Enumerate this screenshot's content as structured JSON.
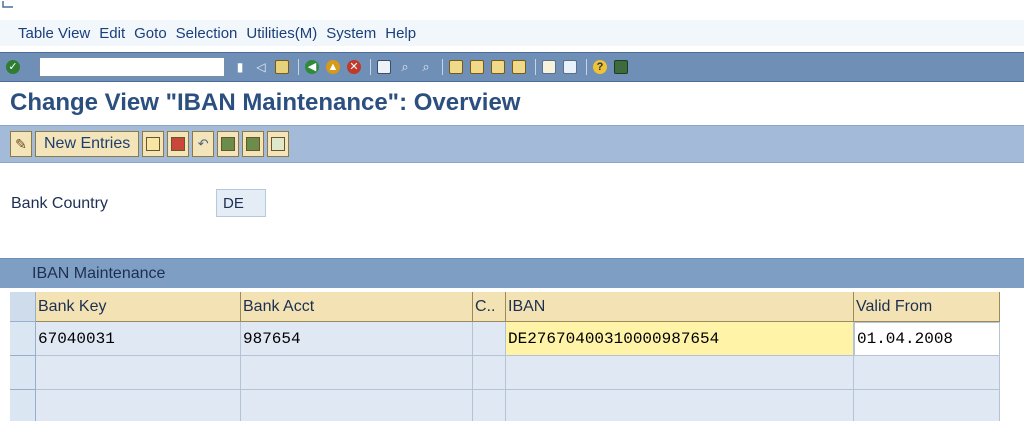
{
  "menu": [
    "Table View",
    "Edit",
    "Goto",
    "Selection",
    "Utilities(M)",
    "System",
    "Help"
  ],
  "title": "Change View \"IBAN Maintenance\": Overview",
  "toolbar_app": {
    "new_entries_label": "New Entries"
  },
  "bank_country": {
    "label": "Bank Country",
    "value": "DE"
  },
  "table": {
    "title": "IBAN Maintenance",
    "headers": [
      "Bank Key",
      "Bank Acct",
      "C..",
      "IBAN",
      "Valid From"
    ],
    "rows": [
      [
        "67040031",
        "987654",
        "",
        "DE27670400310000987654",
        "01.04.2008"
      ],
      [
        "",
        "",
        "",
        "",
        ""
      ],
      [
        "",
        "",
        "",
        "",
        ""
      ]
    ]
  },
  "colors": {
    "system_toolbar": "#6f8fb6",
    "app_toolbar": "#a3bad8",
    "table_title_bar": "#7f9ec4",
    "header_cell": "#f3e2b3",
    "highlight_cell": "#fff3a8",
    "title_text": "#2b4f7f"
  },
  "icons": [
    "enter-check-icon",
    "save-icon",
    "back-icon",
    "exit-icon",
    "cancel-icon",
    "print-icon",
    "find-icon",
    "find-next-icon",
    "first-page-icon",
    "prev-page-icon",
    "next-page-icon",
    "last-page-icon",
    "create-session-icon",
    "shortcut-icon",
    "help-icon",
    "layout-menu-icon"
  ]
}
